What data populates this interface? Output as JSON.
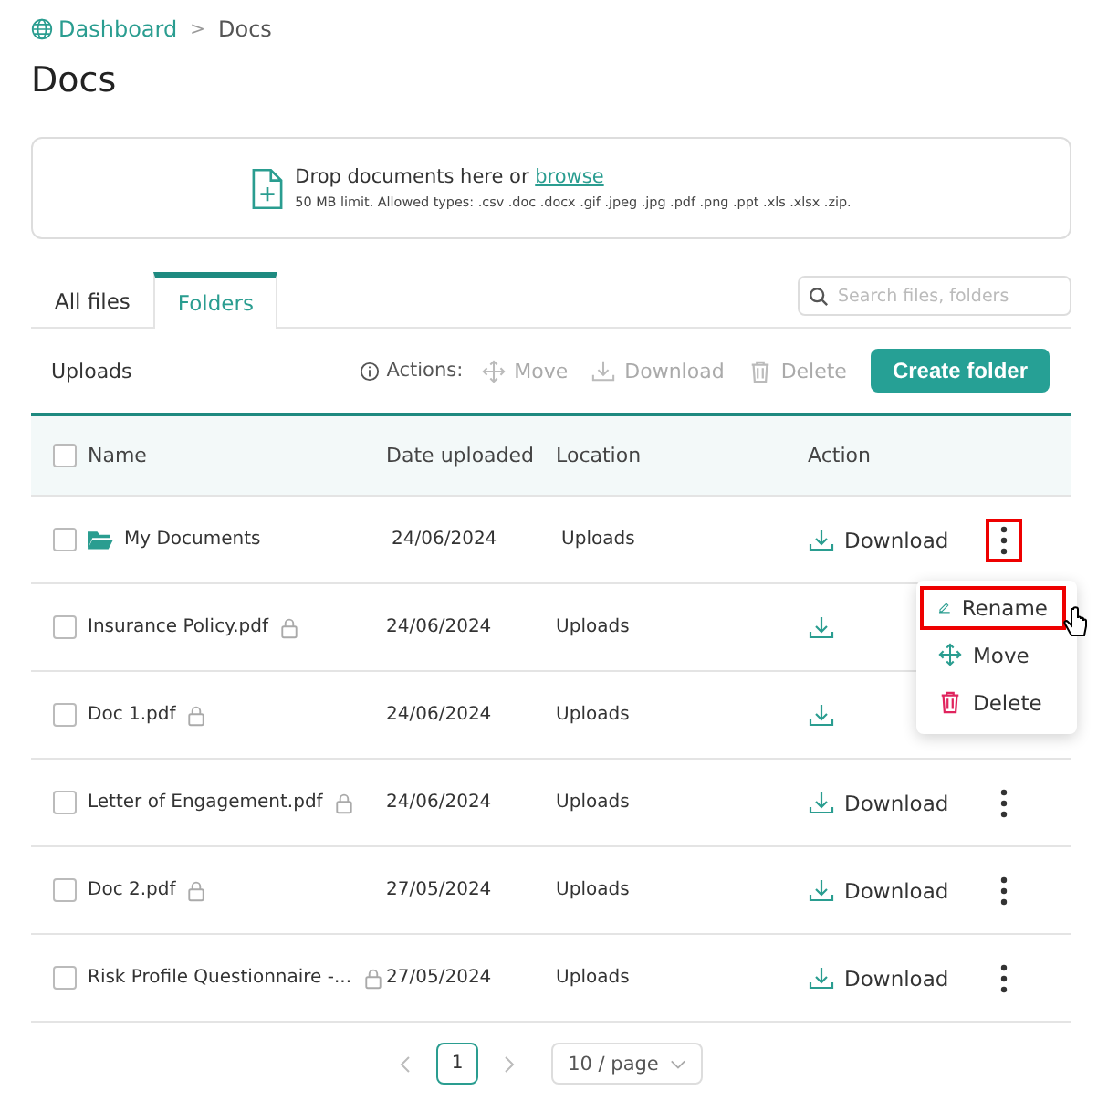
{
  "breadcrumb": [
    {
      "label": "Dashboard",
      "kind": "link"
    },
    {
      "label": ">",
      "kind": "separator"
    },
    {
      "label": "Docs",
      "kind": "current"
    }
  ],
  "title": "Docs",
  "upload": {
    "prompt": "Drop documents here or ",
    "link": "browse",
    "hint": "50 MB limit. Allowed types: .csv .doc .docx .gif .jpeg .jpg .pdf .png .ppt .xls .xlsx .zip."
  },
  "tabs": [
    {
      "label": "All files",
      "selected": false
    },
    {
      "label": "Folders",
      "selected": true
    }
  ],
  "search": {
    "placeholder": "Search files, folders"
  },
  "toolbar": {
    "section": "Uploads",
    "actions_label": "Actions:",
    "actions": [
      {
        "label": "Move",
        "kind": "move"
      },
      {
        "label": "Download",
        "kind": "download"
      },
      {
        "label": "Delete",
        "kind": "delete"
      }
    ],
    "create": "Create folder"
  },
  "table": {
    "select_all_checked": false,
    "columns": [
      "Name",
      "Date uploaded",
      "Location",
      "Action"
    ],
    "rows": [
      {
        "name": "My Documents",
        "kind": "folder",
        "date": "24/06/2024",
        "location": "Uploads",
        "download": "Download",
        "menu": true,
        "checked": false
      },
      {
        "name": "Insurance Policy.pdf",
        "kind": "file",
        "date": "24/06/2024",
        "location": "Uploads",
        "checked": false
      },
      {
        "name": "Doc 1.pdf",
        "kind": "file",
        "date": "24/06/2024",
        "location": "Uploads",
        "checked": false
      },
      {
        "name": "Letter of Engagement.pdf",
        "kind": "file",
        "date": "24/06/2024",
        "location": "Uploads",
        "download": "Download",
        "menu": true,
        "checked": false
      },
      {
        "name": "Doc 2.pdf",
        "kind": "file",
        "date": "27/05/2024",
        "location": "Uploads",
        "download": "Download",
        "menu": true,
        "checked": false
      },
      {
        "name": "Risk Profile Questionnaire -...",
        "kind": "file",
        "date": "27/05/2024",
        "location": "Uploads",
        "download": "Download",
        "menu": true,
        "checked": false
      }
    ]
  },
  "row_menu": {
    "items": [
      {
        "label": "Rename",
        "kind": "rename",
        "highlighted": true
      },
      {
        "label": "Move",
        "kind": "move",
        "highlighted": false
      },
      {
        "label": "Delete",
        "kind": "delete",
        "highlighted": false
      }
    ]
  },
  "pagination": {
    "pages": [
      {
        "label": "1",
        "selected": true
      }
    ],
    "page_size": "10 / page"
  }
}
